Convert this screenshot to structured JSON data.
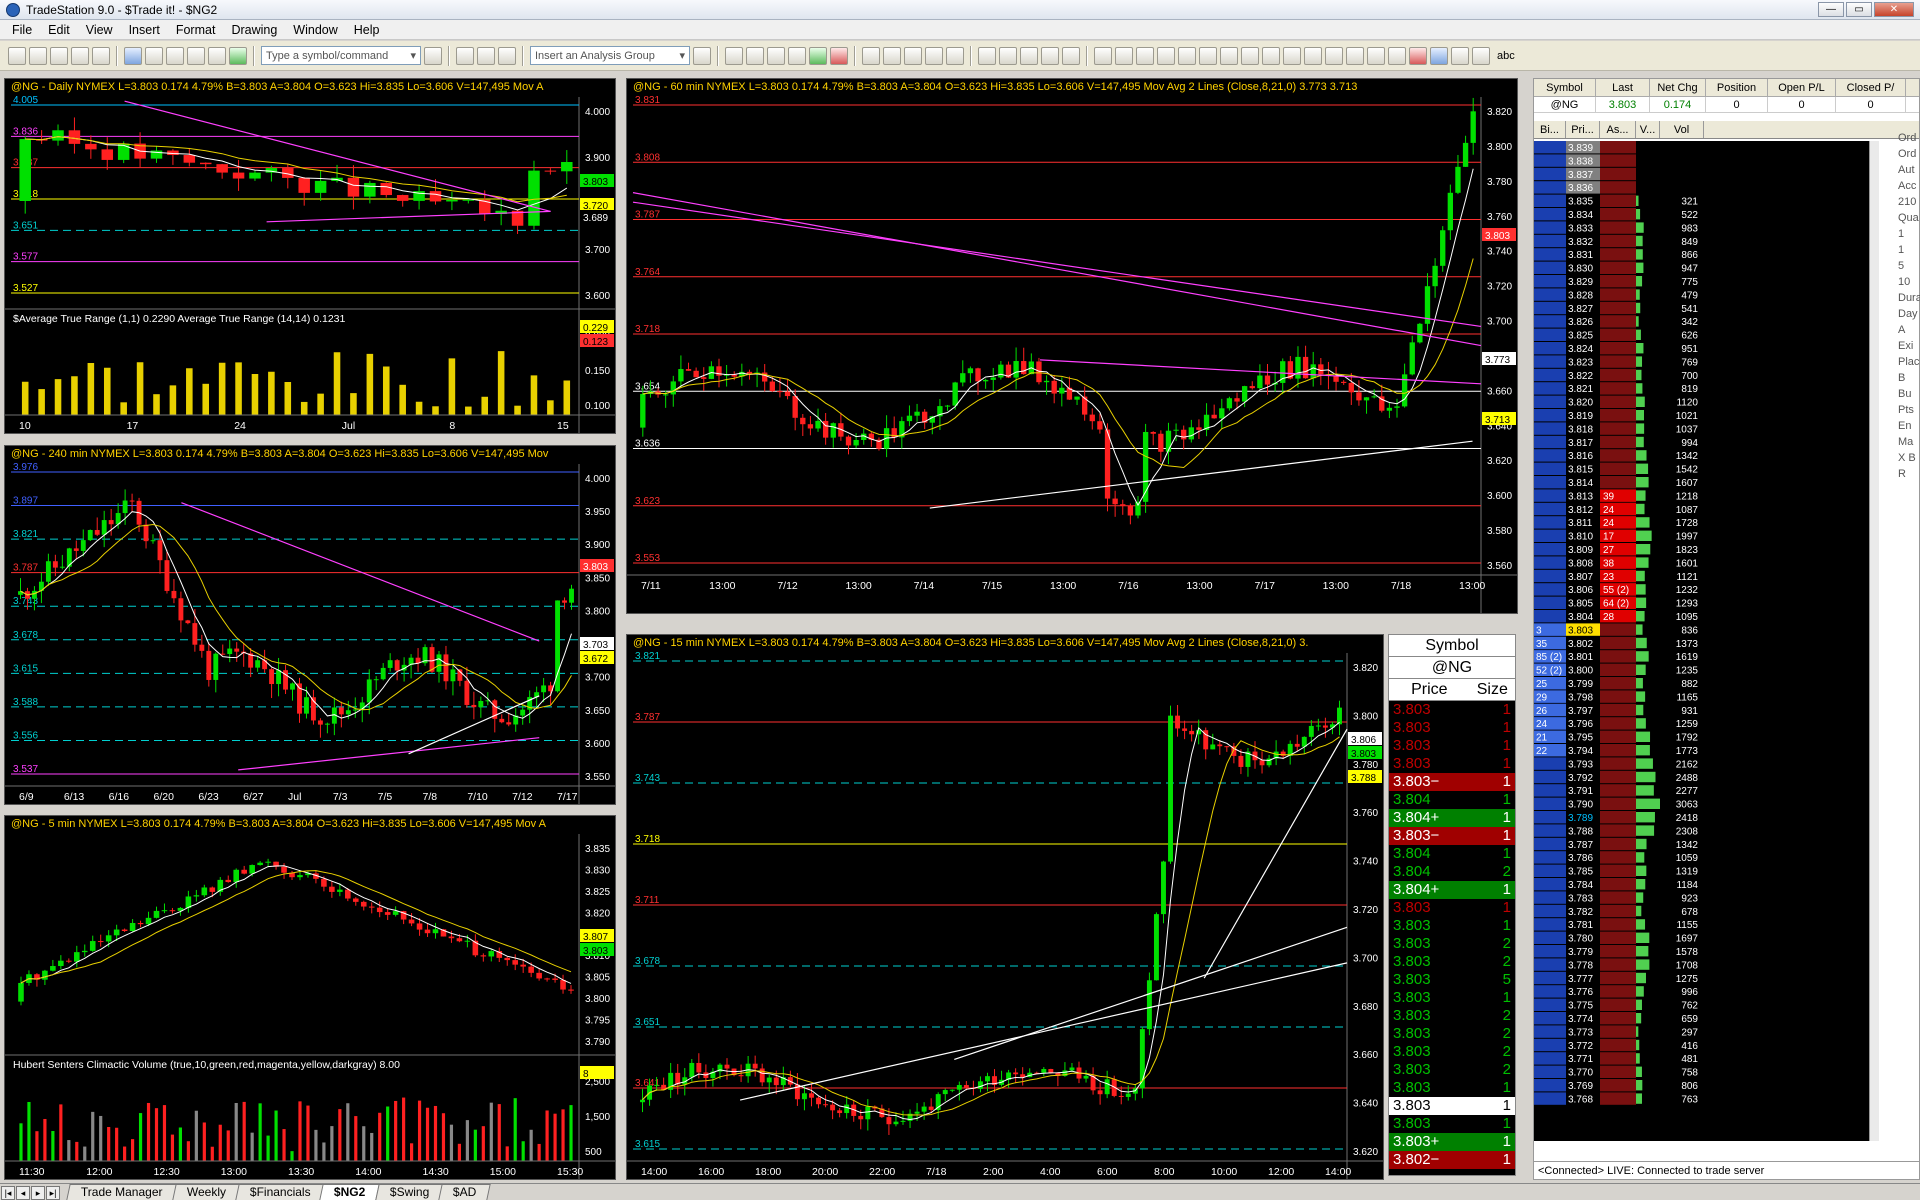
{
  "window": {
    "title": "TradeStation 9.0 - $Trade it! - $NG2",
    "btn_min": "—",
    "btn_max": "▭",
    "btn_close": "✕"
  },
  "menu": [
    "File",
    "Edit",
    "View",
    "Insert",
    "Format",
    "Drawing",
    "Window",
    "Help"
  ],
  "toolbar": {
    "symbol_placeholder": "Type a symbol/command",
    "analysis_placeholder": "Insert an Analysis Group",
    "abc_label": "abc"
  },
  "tabs": [
    "Trade Manager",
    "Weekly",
    "$Financials",
    "$NG2",
    "$Swing",
    "$AD"
  ],
  "active_tab": "$NG2",
  "charts": [
    {
      "id": "daily",
      "title": "@NG - Daily  NYMEX  L=3.803  0.174  4.79%  B=3.803  A=3.804  O=3.623  Hi=3.835  Lo=3.606  V=147,495  Mov A",
      "left_labels": [
        {
          "t": "4.005",
          "c": "#00c0ff"
        },
        {
          "t": "3.836",
          "c": "#ff40ff"
        },
        {
          "t": "3.787",
          "c": "#ff3030"
        },
        {
          "t": "3.718",
          "c": "#ffff00"
        },
        {
          "t": "3.651",
          "c": "#00d0d0"
        },
        {
          "t": "3.577",
          "c": "#ff40ff"
        },
        {
          "t": "3.527",
          "c": "#ffff00"
        }
      ],
      "axis": [
        "4.000",
        "3.900",
        "3.800",
        "3.700",
        "3.600"
      ],
      "badges": [
        {
          "t": "3.803",
          "c": "#00e000"
        },
        {
          "t": "3.720",
          "c": "#ffff00"
        },
        {
          "t": "3.689",
          "c": "#000000"
        }
      ],
      "subtitle": "$Average True Range (1,1)  0.2290  Average True Range (14,14)  0.1231",
      "sub_axis": [
        "0.200",
        "0.150",
        "0.100"
      ],
      "sub_badges": [
        {
          "t": "0.229",
          "c": "#ffff00"
        },
        {
          "t": "0.123",
          "c": "#ff3030"
        }
      ],
      "x_labels": [
        "10",
        "17",
        "24",
        "Jul",
        "8",
        "15"
      ]
    },
    {
      "id": "min240",
      "title": "@NG - 240 min  NYMEX  L=3.803  0.174  4.79%  B=3.803  A=3.804  O=3.623  Hi=3.835  Lo=3.606  V=147,495  Mov",
      "left_labels": [
        {
          "t": "3.976",
          "c": "#4060ff"
        },
        {
          "t": "3.897",
          "c": "#4060ff"
        },
        {
          "t": "3.821",
          "c": "#00d0d0"
        },
        {
          "t": "3.787",
          "c": "#ff3030"
        },
        {
          "t": "3.743",
          "c": "#00d0d0"
        },
        {
          "t": "3.678",
          "c": "#00d0d0"
        },
        {
          "t": "3.615",
          "c": "#00d0d0"
        },
        {
          "t": "3.588",
          "c": "#00d0d0"
        },
        {
          "t": "3.556",
          "c": "#00d0d0"
        },
        {
          "t": "3.537",
          "c": "#ff40ff"
        }
      ],
      "axis": [
        "4.000",
        "3.950",
        "3.900",
        "3.850",
        "3.800",
        "3.750",
        "3.700",
        "3.650",
        "3.600",
        "3.550"
      ],
      "badges": [
        {
          "t": "3.803",
          "c": "#ff3030"
        },
        {
          "t": "3.703",
          "c": "#ffffff"
        },
        {
          "t": "3.672",
          "c": "#ffff00"
        }
      ],
      "x_labels": [
        "6/9",
        "6/13",
        "6/16",
        "6/20",
        "6/23",
        "6/27",
        "Jul",
        "7/3",
        "7/5",
        "7/8",
        "7/10",
        "7/12",
        "7/17"
      ]
    },
    {
      "id": "min5",
      "title": "@NG - 5 min  NYMEX  L=3.803  0.174  4.79%  B=3.803  A=3.804  O=3.623  Hi=3.835  Lo=3.606  V=147,495  Mov A",
      "axis": [
        "3.835",
        "3.830",
        "3.825",
        "3.820",
        "3.815",
        "3.810",
        "3.805",
        "3.800",
        "3.795",
        "3.790"
      ],
      "badges": [
        {
          "t": "3.807",
          "c": "#ffff00"
        },
        {
          "t": "3.803",
          "c": "#00e000"
        }
      ],
      "subtitle": "Hubert Senters Climactic Volume (true,10,green,red,magenta,yellow,darkgray)  8.00",
      "sub_axis": [
        "2,500",
        "1,500",
        "500"
      ],
      "sub_badges": [
        {
          "t": "8",
          "c": "#ffff00"
        }
      ],
      "x_labels": [
        "11:30",
        "12:00",
        "12:30",
        "13:00",
        "13:30",
        "14:00",
        "14:30",
        "15:00",
        "15:30"
      ]
    },
    {
      "id": "min60",
      "title": "@NG - 60 min  NYMEX  L=3.803  0.174  4.79%  B=3.803  A=3.804  O=3.623  Hi=3.835  Lo=3.606  V=147,495  Mov Avg 2 Lines (Close,8,21,0)  3.773  3.713",
      "left_labels": [
        {
          "t": "3.831",
          "c": "#ff3030"
        },
        {
          "t": "3.808",
          "c": "#ff3030"
        },
        {
          "t": "3.787",
          "c": "#ff3030"
        },
        {
          "t": "3.764",
          "c": "#ff3030"
        },
        {
          "t": "3.718",
          "c": "#ff3030"
        },
        {
          "t": "3.654",
          "c": "#ffffff"
        },
        {
          "t": "3.636",
          "c": "#ffffff"
        },
        {
          "t": "3.623",
          "c": "#ff3030"
        },
        {
          "t": "3.553",
          "c": "#ff3030"
        }
      ],
      "axis": [
        "3.820",
        "3.800",
        "3.780",
        "3.760",
        "3.740",
        "3.720",
        "3.700",
        "3.680",
        "3.660",
        "3.640",
        "3.620",
        "3.600",
        "3.580",
        "3.560"
      ],
      "badges": [
        {
          "t": "3.803",
          "c": "#ff3030"
        },
        {
          "t": "3.773",
          "c": "#ffffff"
        },
        {
          "t": "3.713",
          "c": "#ffff00"
        }
      ],
      "x_labels": [
        "7/11",
        "13:00",
        "7/12",
        "13:00",
        "7/14",
        "7/15",
        "13:00",
        "7/16",
        "13:00",
        "7/17",
        "13:00",
        "7/18",
        "13:00"
      ]
    },
    {
      "id": "min15",
      "title": "@NG - 15 min  NYMEX  L=3.803  0.174  4.79%  B=3.803  A=3.804  O=3.623  Hi=3.835  Lo=3.606  V=147,495  Mov Avg 2 Lines (Close,8,21,0)  3.",
      "left_labels": [
        {
          "t": "3.821",
          "c": "#00d0d0"
        },
        {
          "t": "3.787",
          "c": "#ff3030"
        },
        {
          "t": "3.743",
          "c": "#00d0d0"
        },
        {
          "t": "3.718",
          "c": "#ffff00"
        },
        {
          "t": "3.711",
          "c": "#ff3030"
        },
        {
          "t": "3.678",
          "c": "#00d0d0"
        },
        {
          "t": "3.651",
          "c": "#00d0d0"
        },
        {
          "t": "3.641",
          "c": "#ff3030"
        },
        {
          "t": "3.615",
          "c": "#00d0d0"
        }
      ],
      "axis": [
        "3.820",
        "3.800",
        "3.780",
        "3.760",
        "3.740",
        "3.720",
        "3.700",
        "3.680",
        "3.660",
        "3.640",
        "3.620"
      ],
      "badges": [
        {
          "t": "3.806",
          "c": "#ffffff"
        },
        {
          "t": "3.803",
          "c": "#00e000"
        },
        {
          "t": "3.788",
          "c": "#ffff00"
        }
      ],
      "x_labels": [
        "14:00",
        "16:00",
        "18:00",
        "20:00",
        "22:00",
        "7/18",
        "2:00",
        "4:00",
        "6:00",
        "8:00",
        "10:00",
        "12:00",
        "14:00"
      ]
    }
  ],
  "time_sales": {
    "symbol_label": "Symbol",
    "symbol": "@NG",
    "price_label": "Price",
    "size_label": "Size",
    "rows": [
      {
        "p": "3.803",
        "s": "1",
        "c": "#c00000",
        "b": "#000"
      },
      {
        "p": "3.803",
        "s": "1",
        "c": "#c00000",
        "b": "#000"
      },
      {
        "p": "3.803",
        "s": "1",
        "c": "#c00000",
        "b": "#000"
      },
      {
        "p": "3.803",
        "s": "1",
        "c": "#c00000",
        "b": "#000"
      },
      {
        "p": "3.803−",
        "s": "1",
        "c": "#ffffff",
        "b": "#a00000"
      },
      {
        "p": "3.804",
        "s": "1",
        "c": "#00c000",
        "b": "#000"
      },
      {
        "p": "3.804+",
        "s": "1",
        "c": "#ffffff",
        "b": "#008000"
      },
      {
        "p": "3.803−",
        "s": "1",
        "c": "#ffffff",
        "b": "#a00000"
      },
      {
        "p": "3.804",
        "s": "1",
        "c": "#00c000",
        "b": "#000"
      },
      {
        "p": "3.804",
        "s": "2",
        "c": "#00c000",
        "b": "#000"
      },
      {
        "p": "3.804+",
        "s": "1",
        "c": "#ffffff",
        "b": "#008000"
      },
      {
        "p": "3.803",
        "s": "1",
        "c": "#c00000",
        "b": "#000"
      },
      {
        "p": "3.803",
        "s": "1",
        "c": "#00c000",
        "b": "#000"
      },
      {
        "p": "3.803",
        "s": "2",
        "c": "#00c000",
        "b": "#000"
      },
      {
        "p": "3.803",
        "s": "2",
        "c": "#00c000",
        "b": "#000"
      },
      {
        "p": "3.803",
        "s": "5",
        "c": "#00c000",
        "b": "#000"
      },
      {
        "p": "3.803",
        "s": "1",
        "c": "#00c000",
        "b": "#000"
      },
      {
        "p": "3.803",
        "s": "2",
        "c": "#00c000",
        "b": "#000"
      },
      {
        "p": "3.803",
        "s": "2",
        "c": "#00c000",
        "b": "#000"
      },
      {
        "p": "3.803",
        "s": "2",
        "c": "#00c000",
        "b": "#000"
      },
      {
        "p": "3.803",
        "s": "2",
        "c": "#00c000",
        "b": "#000"
      },
      {
        "p": "3.803",
        "s": "1",
        "c": "#00c000",
        "b": "#000"
      },
      {
        "p": "3.803",
        "s": "1",
        "c": "#000000",
        "b": "#ffffff"
      },
      {
        "p": "3.803",
        "s": "1",
        "c": "#00c000",
        "b": "#000"
      },
      {
        "p": "3.803+",
        "s": "1",
        "c": "#ffffff",
        "b": "#008000"
      },
      {
        "p": "3.802−",
        "s": "1",
        "c": "#ffffff",
        "b": "#a00000"
      }
    ]
  },
  "radar": {
    "headers": [
      "Symbol",
      "Last",
      "Net Chg",
      "Position",
      "Open P/L",
      "Closed P/"
    ],
    "row": [
      "@NG",
      "3.803",
      "0.174",
      "0",
      "0",
      "0"
    ]
  },
  "matrix": {
    "headers": [
      "Bi...",
      "Pri...",
      "As...",
      "V...",
      "Vol"
    ],
    "rows": [
      {
        "p": "3.839",
        "bid": "",
        "ask": "",
        "vol": ""
      },
      {
        "p": "3.838",
        "bid": "",
        "ask": "",
        "vol": ""
      },
      {
        "p": "3.837",
        "bid": "",
        "ask": "",
        "vol": ""
      },
      {
        "p": "3.836",
        "bid": "",
        "ask": "",
        "vol": ""
      },
      {
        "p": "3.835",
        "bid": "",
        "ask": "",
        "vol": "321"
      },
      {
        "p": "3.834",
        "bid": "",
        "ask": "",
        "vol": "522"
      },
      {
        "p": "3.833",
        "bid": "",
        "ask": "",
        "vol": "983"
      },
      {
        "p": "3.832",
        "bid": "",
        "ask": "",
        "vol": "849"
      },
      {
        "p": "3.831",
        "bid": "",
        "ask": "",
        "vol": "866"
      },
      {
        "p": "3.830",
        "bid": "",
        "ask": "",
        "vol": "947"
      },
      {
        "p": "3.829",
        "bid": "",
        "ask": "",
        "vol": "775"
      },
      {
        "p": "3.828",
        "bid": "",
        "ask": "",
        "vol": "479"
      },
      {
        "p": "3.827",
        "bid": "",
        "ask": "",
        "vol": "541"
      },
      {
        "p": "3.826",
        "bid": "",
        "ask": "",
        "vol": "342"
      },
      {
        "p": "3.825",
        "bid": "",
        "ask": "",
        "vol": "626"
      },
      {
        "p": "3.824",
        "bid": "",
        "ask": "",
        "vol": "951"
      },
      {
        "p": "3.823",
        "bid": "",
        "ask": "",
        "vol": "769"
      },
      {
        "p": "3.822",
        "bid": "",
        "ask": "",
        "vol": "700"
      },
      {
        "p": "3.821",
        "bid": "",
        "ask": "",
        "vol": "819"
      },
      {
        "p": "3.820",
        "bid": "",
        "ask": "",
        "vol": "1120"
      },
      {
        "p": "3.819",
        "bid": "",
        "ask": "",
        "vol": "1021"
      },
      {
        "p": "3.818",
        "bid": "",
        "ask": "",
        "vol": "1037"
      },
      {
        "p": "3.817",
        "bid": "",
        "ask": "",
        "vol": "994"
      },
      {
        "p": "3.816",
        "bid": "",
        "ask": "",
        "vol": "1342"
      },
      {
        "p": "3.815",
        "bid": "",
        "ask": "",
        "vol": "1542"
      },
      {
        "p": "3.814",
        "bid": "",
        "ask": "",
        "vol": "1607"
      },
      {
        "p": "3.813",
        "bid": "",
        "ask": "39",
        "vol": "1218"
      },
      {
        "p": "3.812",
        "bid": "",
        "ask": "24",
        "vol": "1087"
      },
      {
        "p": "3.811",
        "bid": "",
        "ask": "24",
        "vol": "1728"
      },
      {
        "p": "3.810",
        "bid": "",
        "ask": "17",
        "vol": "1997"
      },
      {
        "p": "3.809",
        "bid": "",
        "ask": "27",
        "vol": "1823"
      },
      {
        "p": "3.808",
        "bid": "",
        "ask": "38",
        "vol": "1601"
      },
      {
        "p": "3.807",
        "bid": "",
        "ask": "23",
        "vol": "1121"
      },
      {
        "p": "3.806",
        "bid": "",
        "ask": "55 (2)",
        "vol": "1232"
      },
      {
        "p": "3.805",
        "bid": "",
        "ask": "64 (2)",
        "vol": "1293"
      },
      {
        "p": "3.804",
        "bid": "",
        "ask": "28",
        "vol": "1095"
      },
      {
        "p": "3.803",
        "bid": "3",
        "ask": "",
        "vol": "836"
      },
      {
        "p": "3.802",
        "bid": "35",
        "ask": "",
        "vol": "1373"
      },
      {
        "p": "3.801",
        "bid": "85 (2)",
        "ask": "",
        "vol": "1619"
      },
      {
        "p": "3.800",
        "bid": "52 (2)",
        "ask": "",
        "vol": "1235"
      },
      {
        "p": "3.799",
        "bid": "25",
        "ask": "",
        "vol": "882"
      },
      {
        "p": "3.798",
        "bid": "29",
        "ask": "",
        "vol": "1165"
      },
      {
        "p": "3.797",
        "bid": "26",
        "ask": "",
        "vol": "931"
      },
      {
        "p": "3.796",
        "bid": "24",
        "ask": "",
        "vol": "1259"
      },
      {
        "p": "3.795",
        "bid": "21",
        "ask": "",
        "vol": "1792"
      },
      {
        "p": "3.794",
        "bid": "22",
        "ask": "",
        "vol": "1773"
      },
      {
        "p": "3.793",
        "bid": "",
        "ask": "",
        "vol": "2162"
      },
      {
        "p": "3.792",
        "bid": "",
        "ask": "",
        "vol": "2488"
      },
      {
        "p": "3.791",
        "bid": "",
        "ask": "",
        "vol": "2277"
      },
      {
        "p": "3.790",
        "bid": "",
        "ask": "",
        "vol": "3063"
      },
      {
        "p": "3.789",
        "bid": "",
        "ask": "",
        "vol": "2418"
      },
      {
        "p": "3.788",
        "bid": "",
        "ask": "",
        "vol": "2308"
      },
      {
        "p": "3.787",
        "bid": "",
        "ask": "",
        "vol": "1342"
      },
      {
        "p": "3.786",
        "bid": "",
        "ask": "",
        "vol": "1059"
      },
      {
        "p": "3.785",
        "bid": "",
        "ask": "",
        "vol": "1319"
      },
      {
        "p": "3.784",
        "bid": "",
        "ask": "",
        "vol": "1184"
      },
      {
        "p": "3.783",
        "bid": "",
        "ask": "",
        "vol": "923"
      },
      {
        "p": "3.782",
        "bid": "",
        "ask": "",
        "vol": "678"
      },
      {
        "p": "3.781",
        "bid": "",
        "ask": "",
        "vol": "1155"
      },
      {
        "p": "3.780",
        "bid": "",
        "ask": "",
        "vol": "1697"
      },
      {
        "p": "3.779",
        "bid": "",
        "ask": "",
        "vol": "1578"
      },
      {
        "p": "3.778",
        "bid": "",
        "ask": "",
        "vol": "1708"
      },
      {
        "p": "3.777",
        "bid": "",
        "ask": "",
        "vol": "1275"
      },
      {
        "p": "3.776",
        "bid": "",
        "ask": "",
        "vol": "996"
      },
      {
        "p": "3.775",
        "bid": "",
        "ask": "",
        "vol": "762"
      },
      {
        "p": "3.774",
        "bid": "",
        "ask": "",
        "vol": "659"
      },
      {
        "p": "3.773",
        "bid": "",
        "ask": "",
        "vol": "297"
      },
      {
        "p": "3.772",
        "bid": "",
        "ask": "",
        "vol": "416"
      },
      {
        "p": "3.771",
        "bid": "",
        "ask": "",
        "vol": "481"
      },
      {
        "p": "3.770",
        "bid": "",
        "ask": "",
        "vol": "758"
      },
      {
        "p": "3.769",
        "bid": "",
        "ask": "",
        "vol": "806"
      },
      {
        "p": "3.768",
        "bid": "",
        "ask": "",
        "vol": "763"
      }
    ]
  },
  "order_bar": [
    "Ord",
    "Ord",
    "Aut",
    "Acc",
    "210",
    "Qua",
    "1",
    "1",
    "5",
    "10",
    "Dura",
    "Day",
    "A",
    "Exi",
    "Plac",
    "B",
    "Bu",
    "Pts",
    "En",
    "Ma",
    "X B",
    "R"
  ],
  "status": "<Connected> LIVE:  Connected to trade server"
}
